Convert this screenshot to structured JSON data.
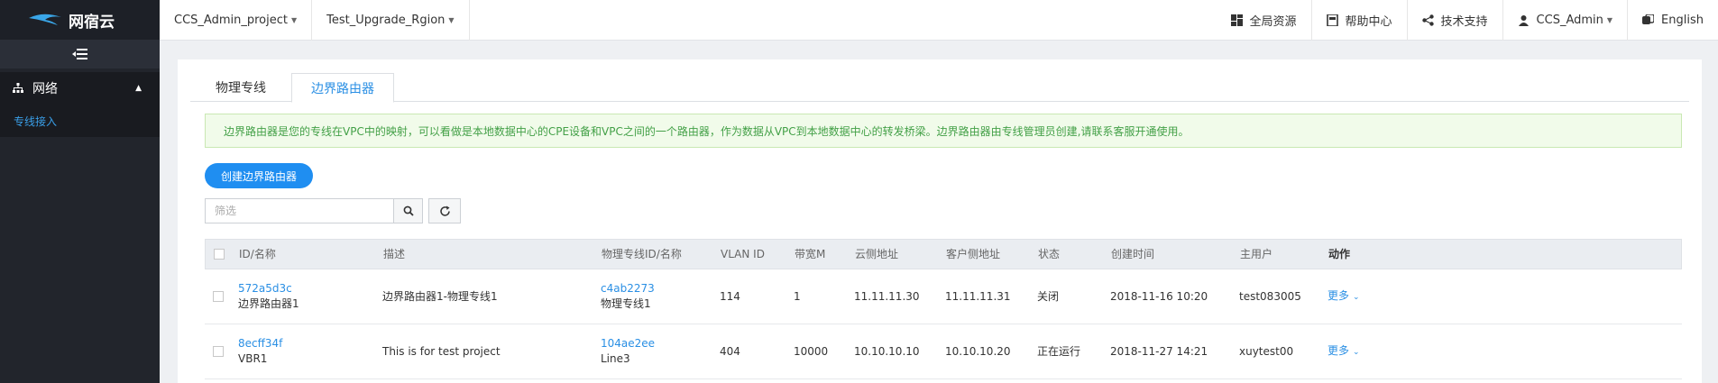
{
  "app": {
    "logo_text": "网宿云"
  },
  "sidebar": {
    "group_label": "网络",
    "sub_item_label": "专线接入"
  },
  "header": {
    "project": "CCS_Admin_project",
    "region": "Test_Upgrade_Rgion",
    "items": [
      {
        "label": "全局资源",
        "icon": "dashboard-icon"
      },
      {
        "label": "帮助中心",
        "icon": "book-icon"
      },
      {
        "label": "技术支持",
        "icon": "share-icon"
      },
      {
        "label": "CCS_Admin",
        "icon": "user-icon"
      },
      {
        "label": "English",
        "icon": "language-icon"
      }
    ]
  },
  "tabs": [
    {
      "label": "物理专线",
      "active": false
    },
    {
      "label": "边界路由器",
      "active": true
    }
  ],
  "notice": "边界路由器是您的专线在VPC中的映射，可以看做是本地数据中心的CPE设备和VPC之间的一个路由器，作为数据从VPC到本地数据中心的转发桥梁。边界路由器由专线管理员创建,请联系客服开通使用。",
  "toolbar": {
    "create_label": "创建边界路由器",
    "filter_placeholder": "筛选"
  },
  "table": {
    "columns": [
      "ID/名称",
      "描述",
      "物理专线ID/名称",
      "VLAN ID",
      "带宽M",
      "云侧地址",
      "客户侧地址",
      "状态",
      "创建时间",
      "主用户",
      "动作"
    ],
    "rows": [
      {
        "id": "572a5d3c",
        "name": "边界路由器1",
        "desc": "边界路由器1-物理专线1",
        "line_id": "c4ab2273",
        "line_name": "物理专线1",
        "vlan": "114",
        "bandwidth": "1",
        "cloud_addr": "11.11.11.30",
        "cust_addr": "11.11.11.31",
        "status": "关闭",
        "created": "2018-11-16 10:20",
        "owner": "test083005",
        "action": "更多"
      },
      {
        "id": "8ecff34f",
        "name": "VBR1",
        "desc": "This is for test project",
        "line_id": "104ae2ee",
        "line_name": "Line3",
        "vlan": "404",
        "bandwidth": "10000",
        "cloud_addr": "10.10.10.10",
        "cust_addr": "10.10.10.20",
        "status": "正在运行",
        "created": "2018-11-27 14:21",
        "owner": "xuytest00",
        "action": "更多"
      }
    ]
  },
  "colors": {
    "accent": "#1f8ef1",
    "sidebar_bg": "#22252c",
    "notice_text": "#43a047"
  }
}
